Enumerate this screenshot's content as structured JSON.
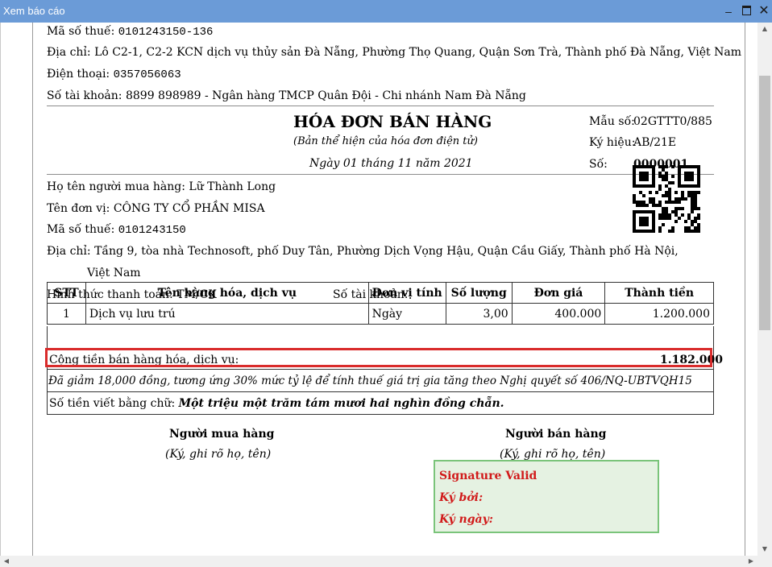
{
  "window": {
    "title": "Xem báo cáo"
  },
  "seller": {
    "tax_label": "Mã số thuế:",
    "tax_code": "0101243150-136",
    "address_label": "Địa chỉ:",
    "address": "Lô C2-1, C2-2 KCN dịch vụ thủy sản Đà Nẵng, Phường Thọ Quang, Quận Sơn Trà, Thành phố Đà Nẵng, Việt Nam",
    "phone_label": "Điện thoại:",
    "phone": "0357056063",
    "account_label": "Số tài khoản:",
    "account": "8899 898989 - Ngân hàng TMCP Quân Đội - Chi nhánh Nam Đà Nẵng"
  },
  "invoice": {
    "title": "HÓA ĐƠN BÁN HÀNG",
    "subtitle": "(Bản thể hiện của hóa đơn điện tử)",
    "date": "Ngày 01 tháng 11 năm 2021",
    "form_label": "Mẫu số:",
    "form_value": "02GTTT0/885",
    "symbol_label": "Ký hiệu:",
    "symbol_value": "AB/21E",
    "number_label": "Số:",
    "number_value": "0000001"
  },
  "buyer": {
    "name_label": "Họ tên người mua hàng:",
    "name": "Lữ Thành Long",
    "unit_label": "Tên đơn vị:",
    "unit": "CÔNG TY CỔ PHẦN MISA",
    "tax_label": "Mã số thuế:",
    "tax_code": "0101243150",
    "address_label": "Địa chỉ:",
    "address_line1": "Tầng 9, tòa nhà Technosoft, phố Duy Tân, Phường Dịch Vọng Hậu, Quận Cầu Giấy, Thành phố Hà Nội,",
    "address_line2": "Việt Nam",
    "payment_label": "Hình thức thanh toán:",
    "payment": "TM/CK",
    "account_label": "Số tài khoản:"
  },
  "table": {
    "headers": [
      "STT",
      "Tên hàng hóa, dịch vụ",
      "Đơn vị tính",
      "Số lượng",
      "Đơn giá",
      "Thành tiền"
    ],
    "rows": [
      [
        "1",
        "Dịch vụ lưu trú",
        "Ngày",
        "3,00",
        "400.000",
        "1.200.000"
      ]
    ]
  },
  "totals": {
    "total_label": "Cộng tiền bán hàng hóa, dịch vụ:",
    "total_value": "1.182.000",
    "discount_note": "Đã giảm 18,000 đồng, tương ứng 30% mức tỷ lệ để tính thuế giá trị gia tăng theo Nghị quyết số 406/NQ-UBTVQH15",
    "words_label": "Số tiền viết bằng chữ:",
    "words_value": "Một triệu một trăm tám mươi hai nghìn đồng chẵn."
  },
  "signatures": {
    "buyer_title": "Người mua hàng",
    "buyer_hint": "(Ký, ghi rõ họ, tên)",
    "seller_title": "Người bán hàng",
    "seller_hint": "(Ký, ghi rõ họ, tên)"
  },
  "signature_box": {
    "status": "Signature Valid",
    "signed_by_label": "Ký bởi:",
    "signed_date_label": "Ký ngày:",
    "background_color": "#e5f2e2",
    "text_color": "#d11a1a"
  },
  "highlight": {
    "color": "#d92b2b"
  }
}
